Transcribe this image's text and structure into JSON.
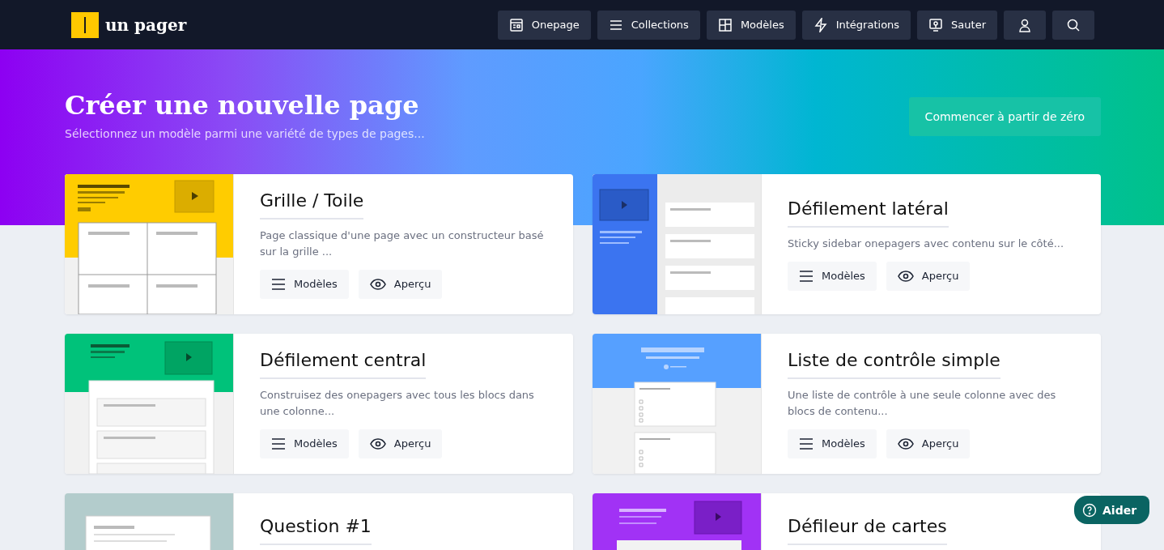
{
  "nav": {
    "logo": "un pager",
    "items": [
      {
        "label": "Onepage"
      },
      {
        "label": "Collections"
      },
      {
        "label": "Modèles"
      },
      {
        "label": "Intégrations"
      },
      {
        "label": "Sauter"
      }
    ]
  },
  "hero": {
    "title": "Créer une nouvelle page",
    "subtitle": "Sélectionnez un modèle parmi une variété de types de pages...",
    "button": "Commencer à partir de zéro"
  },
  "cards": [
    {
      "kind": "grid",
      "color": "#ffcc00",
      "title": "Grille / Toile",
      "description": "Page classique d'une page avec un constructeur basé sur la grille ...",
      "buttons": [
        "Modèles",
        "Aperçu"
      ]
    },
    {
      "kind": "sidebar",
      "color": "#3b74f0",
      "title": "Défilement latéral",
      "description": "Sticky sidebar onepagers avec contenu sur le côté...",
      "buttons": [
        "Modèles",
        "Aperçu"
      ]
    },
    {
      "kind": "central",
      "color": "#00c27a",
      "title": "Défilement central",
      "description": "Construisez des onepagers avec tous les blocs dans une colonne...",
      "buttons": [
        "Modèles",
        "Aperçu"
      ]
    },
    {
      "kind": "checklist",
      "color": "#56a0ff",
      "title": "Liste de contrôle simple",
      "description": "Une liste de contrôle à une seule colonne avec des blocs de contenu...",
      "buttons": [
        "Modèles",
        "Aperçu"
      ]
    },
    {
      "kind": "question",
      "color": "#b3cccc",
      "title": "Question #1"
    },
    {
      "kind": "cards",
      "color": "#a132f5",
      "title": "Défileur de cartes"
    }
  ],
  "help": {
    "label": "Aider"
  }
}
